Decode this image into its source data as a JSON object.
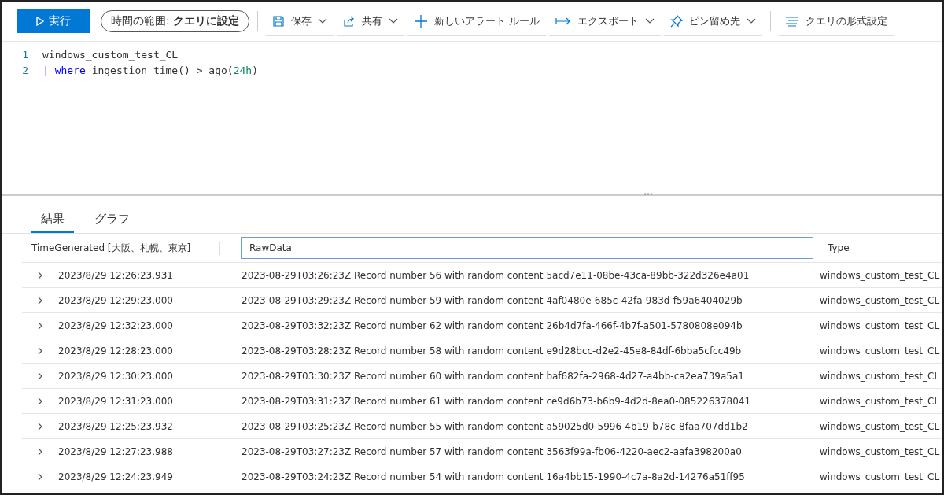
{
  "toolbar": {
    "run_button": {
      "label": "実行"
    },
    "time_range": {
      "label": "時間の範囲: **クエリに設定**"
    },
    "items": [
      {
        "kind": "save",
        "label": "保存",
        "dropdown": true
      },
      {
        "kind": "share",
        "label": "共有",
        "dropdown": true
      },
      {
        "kind": "alert",
        "label": "新しいアラート ルール",
        "dropdown": false
      },
      {
        "kind": "export",
        "label": "エクスポート",
        "dropdown": true
      },
      {
        "kind": "pin",
        "label": "ピン留め先",
        "dropdown": true
      },
      {
        "kind": "format",
        "label": "クエリの形式設定",
        "dropdown": false
      }
    ]
  },
  "editor": {
    "lines": [
      {
        "number": "1",
        "tokens": [
          {
            "kind": "plain",
            "text": "windows_custom_test_CL"
          }
        ]
      },
      {
        "number": "2",
        "tokens": [
          {
            "kind": "pipe",
            "text": "|"
          },
          {
            "kind": "keyword",
            "text": "where"
          },
          {
            "kind": "plain",
            "text": "ingestion_time() > ago("
          },
          {
            "kind": "number",
            "text": "24h"
          },
          {
            "kind": "plain",
            "text": ")"
          }
        ]
      }
    ]
  },
  "results": {
    "tabs": [
      {
        "label": "結果",
        "selected": true
      },
      {
        "label": "グラフ",
        "selected": false
      }
    ],
    "table": {
      "columns": [
        {
          "label": "TimeGenerated [大阪、札幌、東京]",
          "selected": false
        },
        {
          "label": "RawData",
          "selected": true
        },
        {
          "label": "Type",
          "selected": false
        }
      ],
      "rows": [
        {
          "time": "2023/8/29 12:26:23.931",
          "raw": "2023-08-29T03:26:23Z Record number 56 with random content 5acd7e11-08be-43ca-89bb-322d326e4a01",
          "type": "windows_custom_test_CL"
        },
        {
          "time": "2023/8/29 12:29:23.000",
          "raw": "2023-08-29T03:29:23Z Record number 59 with random content 4af0480e-685c-42fa-983d-f59a6404029b",
          "type": "windows_custom_test_CL"
        },
        {
          "time": "2023/8/29 12:32:23.000",
          "raw": "2023-08-29T03:32:23Z Record number 62 with random content 26b4d7fa-466f-4b7f-a501-5780808e094b",
          "type": "windows_custom_test_CL"
        },
        {
          "time": "2023/8/29 12:28:23.000",
          "raw": "2023-08-29T03:28:23Z Record number 58 with random content e9d28bcc-d2e2-45e8-84df-6bba5cfcc49b",
          "type": "windows_custom_test_CL"
        },
        {
          "time": "2023/8/29 12:30:23.000",
          "raw": "2023-08-29T03:30:23Z Record number 60 with random content baf682fa-2968-4d27-a4bb-ca2ea739a5a1",
          "type": "windows_custom_test_CL"
        },
        {
          "time": "2023/8/29 12:31:23.000",
          "raw": "2023-08-29T03:31:23Z Record number 61 with random content ce9d6b73-b6b9-4d2d-8ea0-085226378041",
          "type": "windows_custom_test_CL"
        },
        {
          "time": "2023/8/29 12:25:23.932",
          "raw": "2023-08-29T03:25:23Z Record number 55 with random content a59025d0-5996-4b19-b78c-8faa707dd1b2",
          "type": "windows_custom_test_CL"
        },
        {
          "time": "2023/8/29 12:27:23.988",
          "raw": "2023-08-29T03:27:23Z Record number 57 with random content 3563f99a-fb06-4220-aec2-aafa398200a0",
          "type": "windows_custom_test_CL"
        },
        {
          "time": "2023/8/29 12:24:23.949",
          "raw": "2023-08-29T03:24:23Z Record number 54 with random content 16a4bb15-1990-4c7a-8a2d-14276a51ff95",
          "type": "windows_custom_test_CL"
        }
      ]
    }
  }
}
